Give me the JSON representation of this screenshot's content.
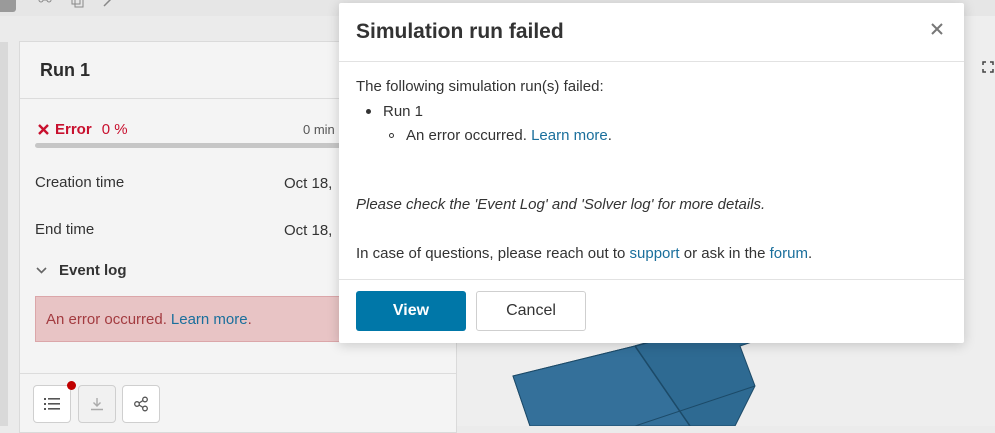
{
  "toolbar": {
    "icons": [
      "share-icon",
      "copy-icon",
      "edit-icon"
    ]
  },
  "run_panel": {
    "title": "Run 1",
    "status_label": "Error",
    "status_percent": "0 %",
    "duration": "0 min",
    "progress_fraction": 0.0,
    "creation_label": "Creation time",
    "creation_value": "Oct 18,",
    "end_label": "End time",
    "end_value": "Oct 18,",
    "event_log_label": "Event log",
    "event_message": "An error occurred.",
    "event_link": "Learn more",
    "event_period": ".",
    "bottom_buttons": [
      "list-icon",
      "download-icon",
      "share-icon"
    ]
  },
  "dialog": {
    "title": "Simulation run failed",
    "intro": "The following simulation run(s) failed:",
    "run_name": "Run 1",
    "error_text": "An error occurred.",
    "error_link": "Learn more",
    "error_period": ".",
    "check_text": "Please check the 'Event Log' and 'Solver log' for more details.",
    "questions_prefix": "In case of questions, please reach out to",
    "support_link": "support",
    "questions_middle": "or ask in the",
    "forum_link": "forum",
    "questions_suffix": ".",
    "view_button": "View",
    "cancel_button": "Cancel"
  },
  "colors": {
    "error": "#c8102e",
    "link": "#1a6f9c",
    "primary_button": "#0077a8",
    "model": "#2e6a92"
  }
}
